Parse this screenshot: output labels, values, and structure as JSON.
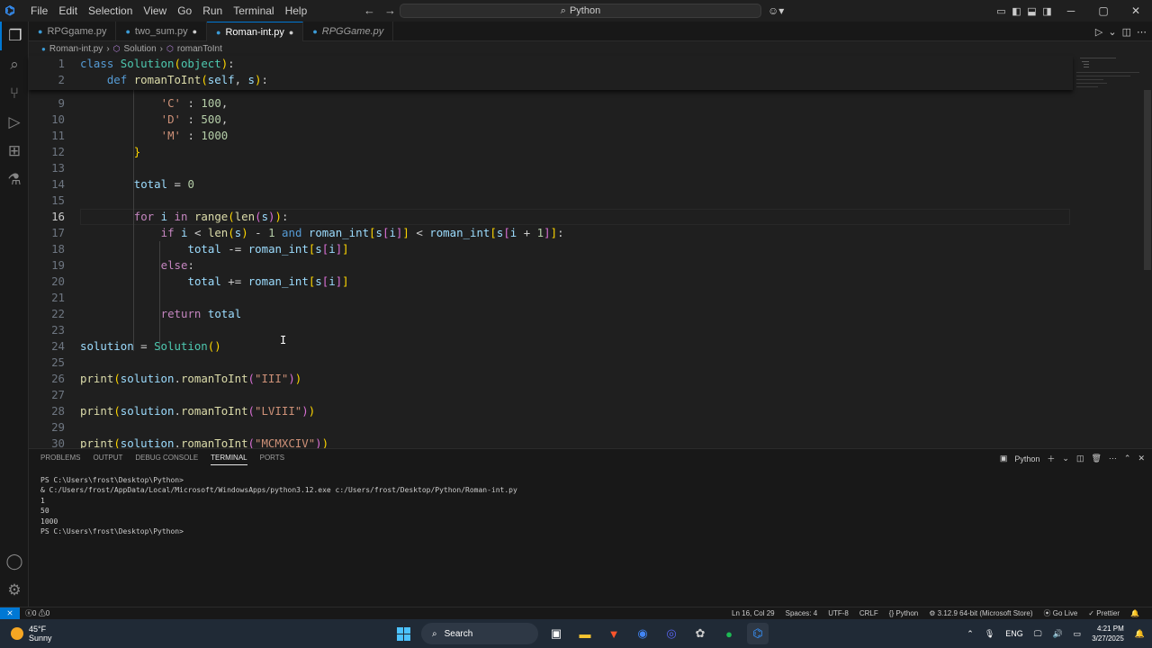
{
  "titlebar": {
    "menu": [
      "File",
      "Edit",
      "Selection",
      "View",
      "Go",
      "Run",
      "Terminal",
      "Help"
    ],
    "search_text": "Python"
  },
  "tabs": [
    {
      "label": "RPGgame.py",
      "modified": false,
      "active": false,
      "italic": false
    },
    {
      "label": "two_sum.py",
      "modified": true,
      "active": false,
      "italic": false
    },
    {
      "label": "Roman-int.py",
      "modified": true,
      "active": true,
      "italic": false
    },
    {
      "label": "RPGGame.py",
      "modified": false,
      "active": false,
      "italic": true
    }
  ],
  "breadcrumb": {
    "file": "Roman-int.py",
    "class": "Solution",
    "method": "romanToInt"
  },
  "sticky": [
    {
      "num": "1",
      "text": "class Solution(object):"
    },
    {
      "num": "2",
      "text": "    def romanToInt(self, s):"
    }
  ],
  "code": [
    {
      "num": "9",
      "text": "            'C' : 100,"
    },
    {
      "num": "10",
      "text": "            'D' : 500,"
    },
    {
      "num": "11",
      "text": "            'M' : 1000"
    },
    {
      "num": "12",
      "text": "        }"
    },
    {
      "num": "13",
      "text": ""
    },
    {
      "num": "14",
      "text": "        total = 0"
    },
    {
      "num": "15",
      "text": ""
    },
    {
      "num": "16",
      "text": "        for i in range(len(s)):"
    },
    {
      "num": "17",
      "text": "            if i < len(s) - 1 and roman_int[s[i]] < roman_int[s[i + 1]]:"
    },
    {
      "num": "18",
      "text": "                total -= roman_int[s[i]]"
    },
    {
      "num": "19",
      "text": "            else:"
    },
    {
      "num": "20",
      "text": "                total += roman_int[s[i]]"
    },
    {
      "num": "21",
      "text": ""
    },
    {
      "num": "22",
      "text": "            return total"
    },
    {
      "num": "23",
      "text": ""
    },
    {
      "num": "24",
      "text": "solution = Solution()"
    },
    {
      "num": "25",
      "text": ""
    },
    {
      "num": "26",
      "text": "print(solution.romanToInt(\"III\"))"
    },
    {
      "num": "27",
      "text": ""
    },
    {
      "num": "28",
      "text": "print(solution.romanToInt(\"LVIII\"))"
    },
    {
      "num": "29",
      "text": ""
    },
    {
      "num": "30",
      "text": "print(solution.romanToInt(\"MCMXCIV\"))"
    }
  ],
  "current_line": "16",
  "panel": {
    "tabs": [
      "PROBLEMS",
      "OUTPUT",
      "DEBUG CONSOLE",
      "TERMINAL",
      "PORTS"
    ],
    "active_tab": "TERMINAL",
    "shell_label": "Python",
    "terminal_lines": [
      "PS C:\\Users\\frost\\Desktop\\Python>",
      "& C:/Users/frost/AppData/Local/Microsoft/WindowsApps/python3.12.exe c:/Users/frost/Desktop/Python/Roman-int.py",
      "1",
      "50",
      "1000",
      "PS C:\\Users\\frost\\Desktop\\Python>"
    ]
  },
  "statusbar": {
    "errors": "0",
    "warnings": "0",
    "position": "Ln 16, Col 29",
    "spaces": "Spaces: 4",
    "encoding": "UTF-8",
    "eol": "CRLF",
    "language": "Python",
    "interpreter": "3.12.9 64-bit (Microsoft Store)",
    "golive": "Go Live",
    "prettier": "Prettier"
  },
  "taskbar": {
    "temp": "45°F",
    "weather": "Sunny",
    "search_label": "Search",
    "lang": "ENG",
    "time": "4:21 PM",
    "date": "3/27/2025"
  },
  "colors": {
    "accent": "#0078d4",
    "editor_bg": "#1f1f1f",
    "sidebar_bg": "#181818"
  }
}
